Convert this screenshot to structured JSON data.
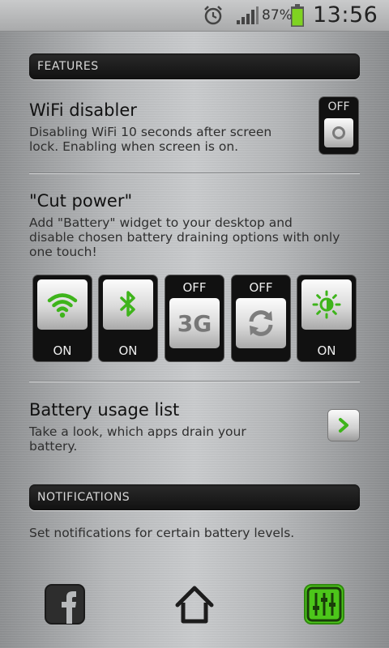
{
  "status_bar": {
    "battery_percent": "87%",
    "time": "13:56",
    "icons": [
      "alarm-icon",
      "signal-icon",
      "battery-icon"
    ],
    "battery_color": "#7fd321"
  },
  "features": {
    "header": "FEATURES",
    "wifi": {
      "title": "WiFi disabler",
      "description_line1": "Disabling WiFi 10 seconds after screen",
      "description_line2": "lock. Enabling when screen is on.",
      "toggle_state": "OFF"
    },
    "cut_power": {
      "title": "\"Cut power\"",
      "description_line1": "Add \"Battery\" widget to your desktop and",
      "description_line2": "disable chosen battery draining options with only",
      "description_line3": "one touch!",
      "tiles": [
        {
          "icon": "wifi-icon",
          "state": "ON"
        },
        {
          "icon": "bluetooth-icon",
          "state": "ON"
        },
        {
          "icon": "3g-icon",
          "label": "3G",
          "state": "OFF"
        },
        {
          "icon": "sync-icon",
          "state": "OFF"
        },
        {
          "icon": "brightness-icon",
          "state": "ON"
        }
      ]
    },
    "battery_usage": {
      "title": "Battery usage list",
      "description_line1": "Take a look, which apps drain your",
      "description_line2": "battery."
    }
  },
  "notifications": {
    "header": "NOTIFICATIONS",
    "description": "Set notifications for certain battery levels."
  },
  "bottom_bar": {
    "icons": [
      "facebook-icon",
      "home-icon",
      "settings-sliders-icon"
    ]
  },
  "colors": {
    "accent_green": "#4cc61a",
    "dark_panel": "#111111"
  }
}
